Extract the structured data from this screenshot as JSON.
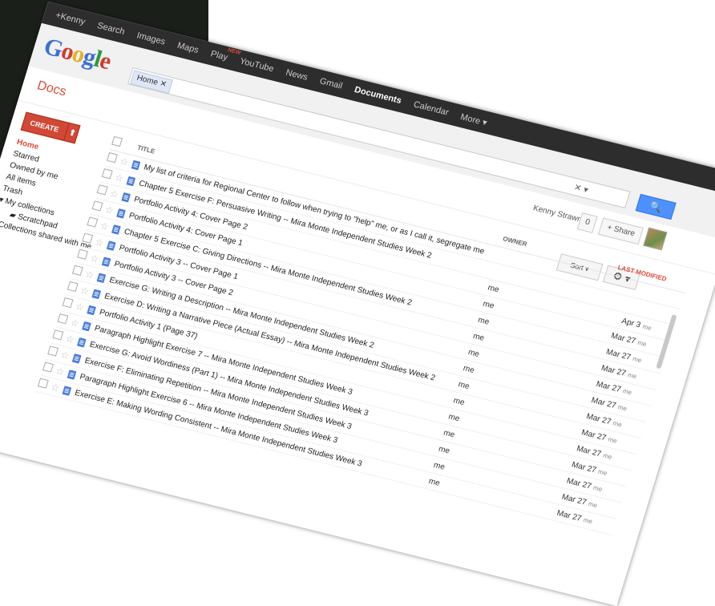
{
  "topbar": {
    "items": [
      "+Kenny",
      "Search",
      "Images",
      "Maps",
      "Play",
      "YouTube",
      "News",
      "Gmail",
      "Documents",
      "Calendar",
      "More ▾"
    ],
    "new_badge": "NEW",
    "active_index": 8
  },
  "header": {
    "logo": {
      "G": "G",
      "o1": "o",
      "o2": "o",
      "g": "g",
      "l": "l",
      "e": "e"
    },
    "chip_label": "Home ✕",
    "search_clear": "✕ ▾",
    "search_button": "🔍"
  },
  "subbar": {
    "title": "Docs",
    "user_name": "Kenny Strawn",
    "count": "0",
    "share_label": "+ Share"
  },
  "sidebar": {
    "create_label": "CREATE",
    "upload_icon": "⬆",
    "items": [
      {
        "label": "Home",
        "selected": true
      },
      {
        "label": "Starred"
      },
      {
        "label": "Owned by me"
      },
      {
        "label": "All items"
      },
      {
        "label": "Trash"
      },
      {
        "label": "▾ My collections"
      },
      {
        "label": "▰ Scratchpad"
      },
      {
        "label": "▸ Collections shared with me"
      }
    ]
  },
  "toolbar": {
    "sort_label": "Sort ▾",
    "gear_label": "⚙ ▾"
  },
  "list": {
    "headers": {
      "title": "TITLE",
      "owner": "OWNER",
      "modified": "LAST MODIFIED"
    },
    "rows": [
      {
        "title": "My list of criteria for Regional Center to follow when trying to \"help\" me, or as I call it, segregate me",
        "owner": "",
        "date": "",
        "time": ""
      },
      {
        "title": "Chapter 5 Exercise F: Persuasive Writing -- Mira Monte Independent Studies Week 2",
        "owner": "",
        "date": "",
        "time": ""
      },
      {
        "title": "Portfolio Activity 4: Cover Page 2",
        "owner": "me",
        "date": "Apr 3",
        "time": "me"
      },
      {
        "title": "Portfolio Activity 4: Cover Page 1",
        "owner": "me",
        "date": "Mar 27",
        "time": "me"
      },
      {
        "title": "Chapter 5 Exercise C: Giving Directions -- Mira Monte Independent Studies Week 2",
        "owner": "me",
        "date": "Mar 27",
        "time": "me"
      },
      {
        "title": "Portfolio Activity 3 -- Cover Page 1",
        "owner": "me",
        "date": "Mar 27",
        "time": "me"
      },
      {
        "title": "Portfolio Activity 3 -- Cover Page 2",
        "owner": "me",
        "date": "Mar 27",
        "time": "me"
      },
      {
        "title": "Exercise G: Writing a Description -- Mira Monte Independent Studies Week 2",
        "owner": "me",
        "date": "Mar 27",
        "time": "me"
      },
      {
        "title": "Exercise D: Writing a Narrative Piece (Actual Essay) -- Mira Monte Independent Studies Week 2",
        "owner": "me",
        "date": "Mar 27",
        "time": "me"
      },
      {
        "title": "Portfolio Activity 1 (Page 37)",
        "owner": "me",
        "date": "Mar 27",
        "time": "me"
      },
      {
        "title": "Paragraph Highlight Exercise 7 -- Mira Monte Independent Studies Week 3",
        "owner": "me",
        "date": "Mar 27",
        "time": "me"
      },
      {
        "title": "Exercise G: Avoid Wordiness (Part 1) -- Mira Monte Independent Studies Week 3",
        "owner": "me",
        "date": "Mar 27",
        "time": "me"
      },
      {
        "title": "Exercise F: Eliminating Repetition -- Mira Monte Independent Studies Week 3",
        "owner": "me",
        "date": "Mar 27",
        "time": "me"
      },
      {
        "title": "Paragraph Highlight Exercise 6 -- Mira Monte Independent Studies Week 3",
        "owner": "me",
        "date": "Mar 27",
        "time": "me"
      },
      {
        "title": "Exercise E: Making Wording Consistent -- Mira Monte Independent Studies Week 3",
        "owner": "me",
        "date": "Mar 27",
        "time": "me"
      }
    ]
  }
}
